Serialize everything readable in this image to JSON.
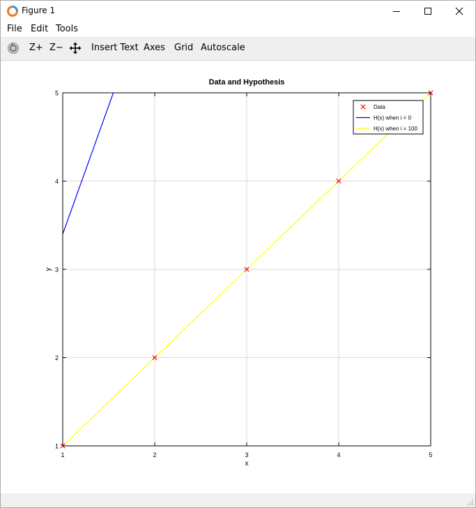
{
  "window": {
    "title": "Figure 1"
  },
  "menu": {
    "file": "File",
    "edit": "Edit",
    "tools": "Tools"
  },
  "toolbar": {
    "rotate_icon": "rotate-icon",
    "zoom_in": "Z+",
    "zoom_out": "Z−",
    "pan_icon": "pan-arrows-icon",
    "insert_text": "Insert Text",
    "axes": "Axes",
    "grid": "Grid",
    "autoscale": "Autoscale"
  },
  "chart_data": {
    "type": "line",
    "title": "Data and Hypothesis",
    "xlabel": "x",
    "ylabel": "y",
    "xlim": [
      1,
      5
    ],
    "ylim": [
      1,
      5
    ],
    "x_ticks": [
      "1",
      "2",
      "3",
      "4",
      "5"
    ],
    "y_ticks": [
      "1",
      "2",
      "3",
      "4",
      "5"
    ],
    "grid": true,
    "legend_position": "top-right",
    "series": [
      {
        "name": "Data",
        "kind": "scatter",
        "marker": "x",
        "color": "#ff0000",
        "x": [
          1,
          2,
          3,
          4,
          5
        ],
        "y": [
          1,
          2,
          3,
          4,
          5
        ]
      },
      {
        "name": "H(x) when i = 0",
        "kind": "line",
        "color": "#0000ff",
        "x": [
          1,
          1.55
        ],
        "y": [
          3.4,
          5
        ]
      },
      {
        "name": "H(x) when i = 100",
        "kind": "line",
        "color": "#ffff00",
        "x": [
          1,
          5
        ],
        "y": [
          1,
          5
        ]
      }
    ]
  }
}
